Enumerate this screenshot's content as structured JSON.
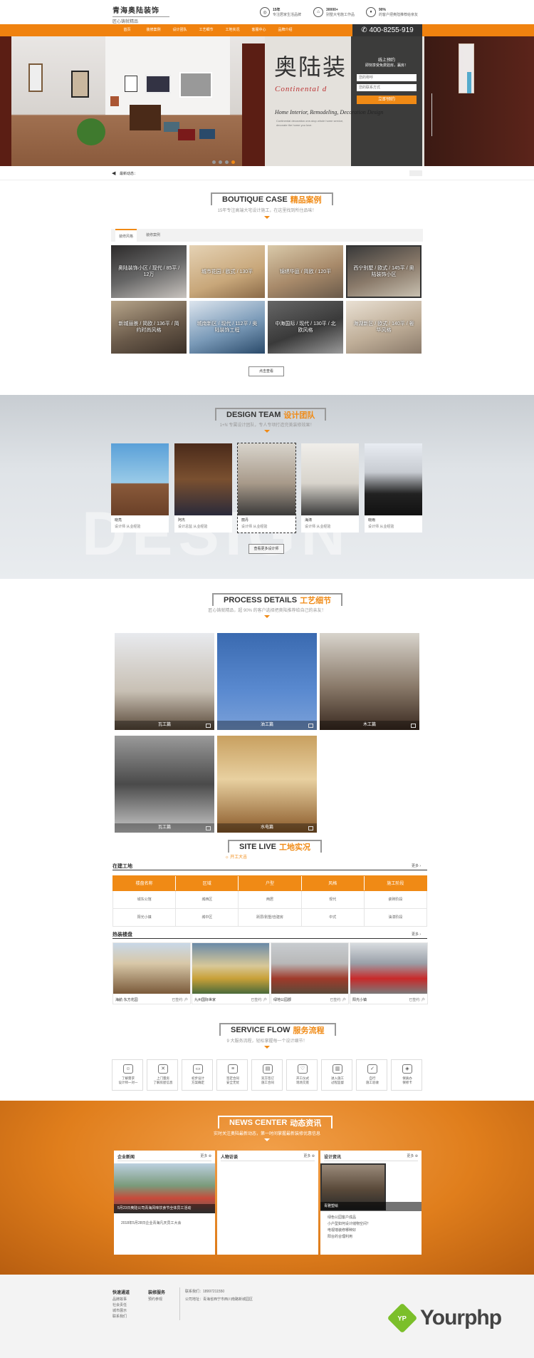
{
  "header": {
    "logo_line1": "青海奥陆装饰",
    "logo_line2": "匠心铸就精品",
    "features": [
      {
        "icon": "medal-icon",
        "title": "15年",
        "desc": "专注居家生活品牌"
      },
      {
        "icon": "house-icon",
        "title": "30000+",
        "desc": "别墅大宅施工作品"
      },
      {
        "icon": "thumb-icon",
        "title": "90%",
        "desc": "的客户把奥陆推荐给亲友"
      }
    ]
  },
  "nav": {
    "items": [
      "首页",
      "装修案例",
      "设计团队",
      "工艺细节",
      "工地实况",
      "客服中心",
      "品牌介绍"
    ],
    "hotline": "400-8255-919"
  },
  "banner": {
    "title": "奥陆装",
    "subtitle": "Continental d",
    "english": "Home Interior, Remodeling, Decoration Design",
    "small_text": "Continental decoration one-stop whole home service, decorate the home you love.",
    "form": {
      "title": "线上预约",
      "subtitle": "即刻享受免费验房，赢房！",
      "name_placeholder": "您的称呼",
      "phone_placeholder": "您的联系方式",
      "submit": "立即预约"
    }
  },
  "ticker": {
    "label": "最新动态："
  },
  "boutique": {
    "title_en": "BOUTIQUE CASE",
    "title_cn": "精品案例",
    "subtitle": "15年专注高端大宅设计施工，在这里找到所住品味！",
    "tabs": [
      "装修风格",
      "装修案例"
    ],
    "cases": [
      "奥陆装饰小区 / 现代 / 85平 / 12万",
      "城市花园 / 欧式 / 130平",
      "锦绣华庭 / 简欧 / 120平",
      "西宁别墅 / 欧式 / 145平 / 奥陆装饰小区",
      "新城丽景 / 简欧 / 136平 / 简约时尚风格",
      "城南新区 / 现代 / 112平 / 奥陆装饰工程",
      "中海国际 / 现代 / 130平 / 北欧风格",
      "海湖新区 / 欧式 / 140平 / 奢华风格"
    ],
    "more": "点击查看"
  },
  "team": {
    "title_en": "DESIGN TEAM",
    "title_cn": "设计团队",
    "subtitle": "1+N 专属设计团队，专人专项打造完美装修效果！",
    "watermark": "DESIGN",
    "members": [
      {
        "name": "晓亮",
        "role": "设计师  从业经验"
      },
      {
        "name": "阿杰",
        "role": "设计总监  从业经验"
      },
      {
        "name": "丽丹",
        "role": "设计师  从业经验"
      },
      {
        "name": "海涛",
        "role": "设计师  从业经验"
      },
      {
        "name": "晓雨",
        "role": "设计师  从业经验"
      }
    ],
    "more": "查看更多设计师"
  },
  "process": {
    "title_en": "PROCESS DETAILS",
    "title_cn": "工艺细节",
    "subtitle": "匠心铸就精品，超 90% 的客户选择把奥陆推荐给自己的亲友！",
    "items": [
      "瓦工篇",
      "油工篇",
      "木工篇",
      "瓦工篇",
      "水电篇"
    ]
  },
  "site": {
    "title_en": "SITE LIVE",
    "title_cn": "工地实况",
    "tag": "开工大吉",
    "live_label": "在建工地",
    "more": "更多",
    "columns": [
      "楼盘名称",
      "区域",
      "户型",
      "风格",
      "施工阶段"
    ],
    "rows": [
      [
        "城东公馆",
        "城西区",
        "两居",
        "现代",
        "瓷砖阶段"
      ],
      [
        "阳光小镇",
        "城中区",
        "跃层/别墅/自建房",
        "中式",
        "油漆阶段"
      ]
    ],
    "hot_label": "热装楼盘",
    "buildings": [
      {
        "name": "海航·东方花园",
        "count": "已签约: 户"
      },
      {
        "name": "九州国际世家",
        "count": "已签约: 户"
      },
      {
        "name": "绿地公园郡",
        "count": "已签约: 户"
      },
      {
        "name": "阳光小镇",
        "count": "已签约: 户"
      }
    ]
  },
  "flow": {
    "title_en": "SERVICE FLOW",
    "title_cn": "服务流程",
    "subtitle": "9 大服务流程，轻松掌握每一个设计细节！",
    "steps": [
      {
        "icon": "user-icon",
        "line1": "了解需求",
        "line2": "设计师一对一"
      },
      {
        "icon": "tools-icon",
        "line1": "上门量房",
        "line2": "了解房屋信息"
      },
      {
        "icon": "monitor-icon",
        "line1": "初步设计",
        "line2": "方案确定"
      },
      {
        "icon": "document-icon",
        "line1": "签定合同",
        "line2": "安全无忧"
      },
      {
        "icon": "contract-icon",
        "line1": "双方签订",
        "line2": "施工合同"
      },
      {
        "icon": "handshake-icon",
        "line1": "开工仪式",
        "line2": "现场交底"
      },
      {
        "icon": "roller-icon",
        "line1": "进入施工",
        "line2": "过程监督"
      },
      {
        "icon": "shield-icon",
        "line1": "自行",
        "line2": "施工验收"
      },
      {
        "icon": "warranty-icon",
        "line1": "保质办",
        "line2": "保修卡"
      }
    ]
  },
  "news": {
    "title_en": "NEWS CENTER",
    "title_cn": "动态资讯",
    "subtitle": "实时关注奥陆最新动态，第一时间掌握最新装修优惠信息",
    "columns": [
      {
        "title": "企业新闻",
        "more": "更多",
        "caption": "5月23日奥陆公司青海风味饮食节全体员工活动",
        "items": [
          "2018年5月28日企业青海凡天员工大会"
        ]
      },
      {
        "title": "人物访谈",
        "more": "更多",
        "caption": "",
        "items": []
      },
      {
        "title": "设计资讯",
        "more": "更多",
        "caption": "青雅塑绘",
        "items": [
          "绿色公园客户成品",
          "小户型如何设计储物空间？",
          "电视墙装修哪种好",
          "阳台的合理利用"
        ]
      }
    ]
  },
  "footer": {
    "col1_title": "快速通道",
    "col1_items": [
      "品牌故事",
      "社会责任",
      "城市展示",
      "联系我们"
    ],
    "col2_title": "装修服务",
    "col2_items": [
      "预约参观"
    ],
    "contact1": "联系我们：18997211550",
    "contact2": "公司地址：青海省西宁市西川南路新城园区"
  },
  "watermark": {
    "text": "Yourphp",
    "mark": "YP"
  }
}
